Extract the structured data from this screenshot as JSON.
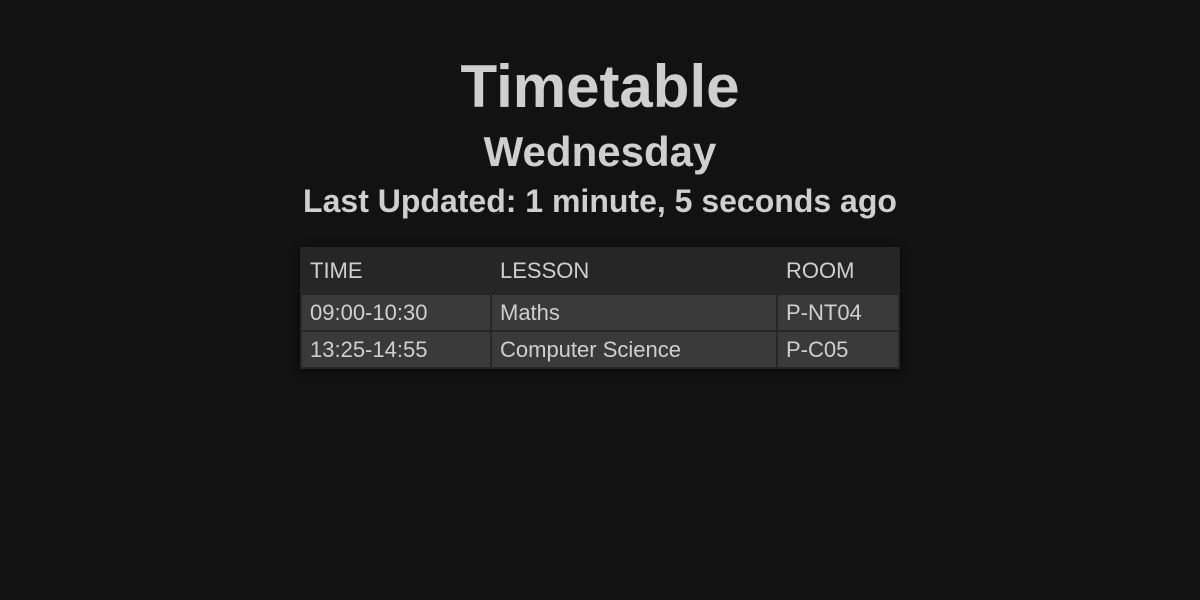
{
  "title": "Timetable",
  "day": "Wednesday",
  "last_updated": "Last Updated: 1 minute, 5 seconds ago",
  "table": {
    "headers": [
      "TIME",
      "LESSON",
      "ROOM"
    ],
    "rows": [
      [
        "09:00-10:30",
        "Maths",
        "P-NT04"
      ],
      [
        "13:25-14:55",
        "Computer Science",
        "P-C05"
      ]
    ]
  }
}
